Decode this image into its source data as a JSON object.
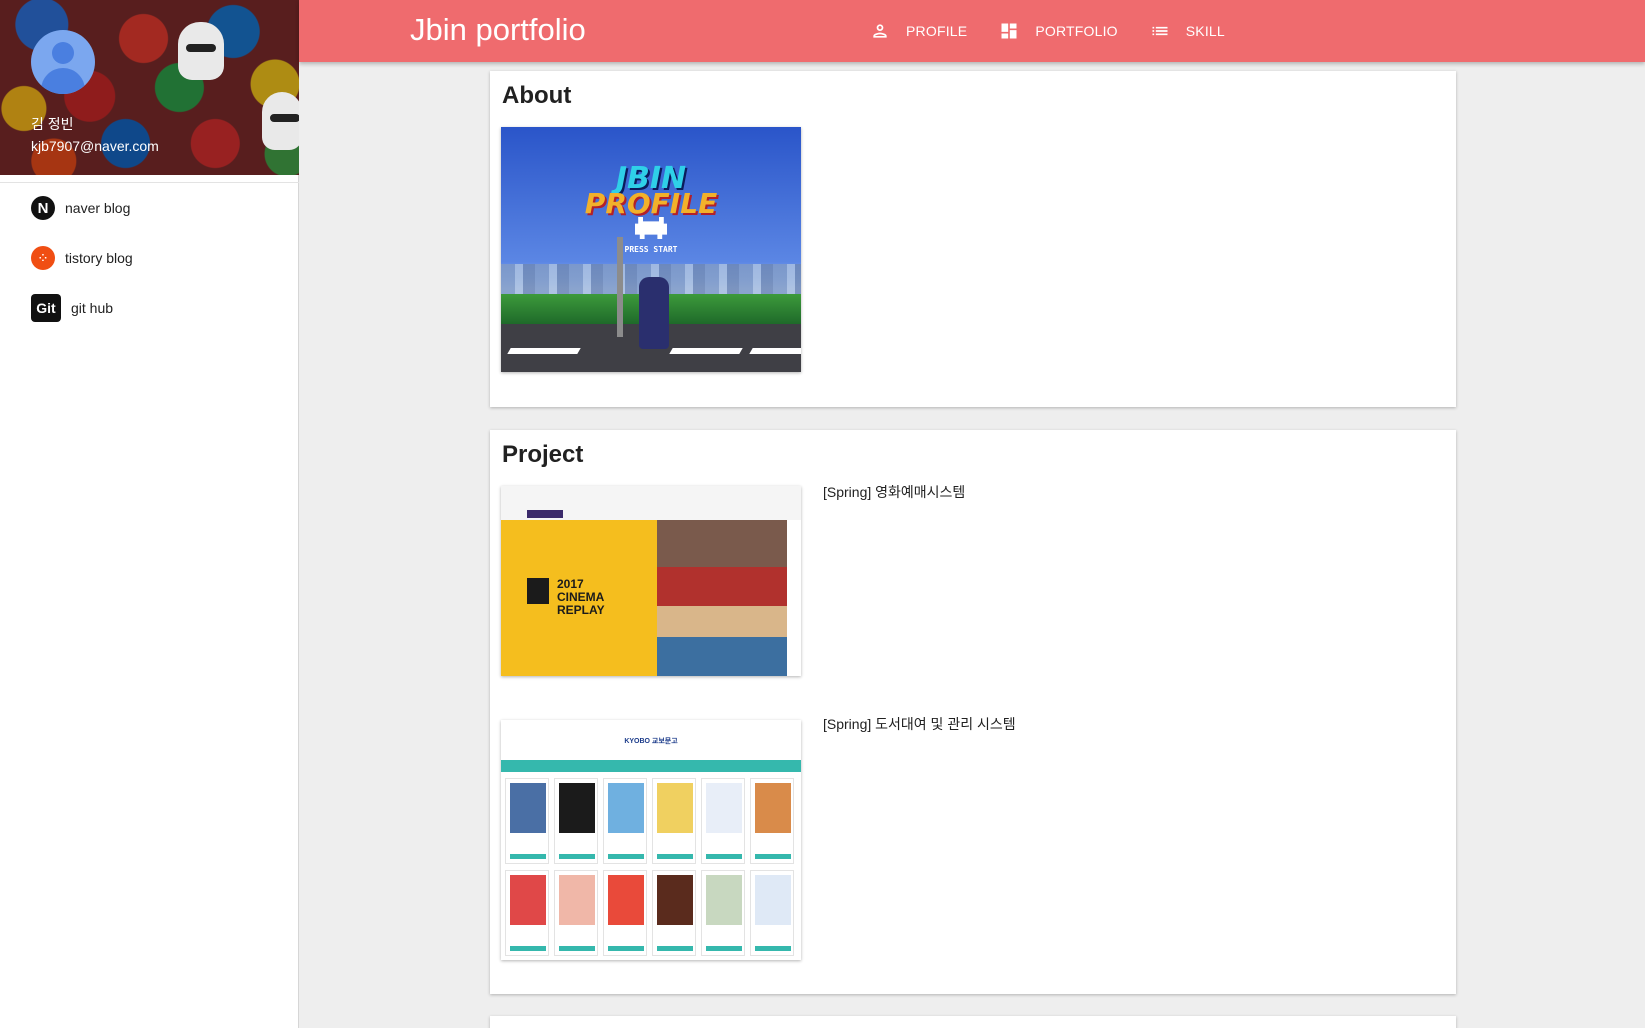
{
  "sidebar": {
    "user_name": "김 정빈",
    "user_email": "kjb7907@naver.com",
    "links": [
      {
        "label": "naver blog",
        "icon": "naver-icon"
      },
      {
        "label": "tistory blog",
        "icon": "tistory-icon"
      },
      {
        "label": "git hub",
        "icon": "github-icon"
      }
    ],
    "icon_glyphs": {
      "naver": "N",
      "tistory": "⁘",
      "git": "Git"
    }
  },
  "appbar": {
    "title": "Jbin portfolio",
    "nav": [
      {
        "label": "PROFILE",
        "icon": "person-icon"
      },
      {
        "label": "PORTFOLIO",
        "icon": "dashboard-icon"
      },
      {
        "label": "SKILL",
        "icon": "list-icon"
      }
    ],
    "color": "#ef6b6e"
  },
  "about": {
    "title": "About",
    "image": {
      "line1": "JBIN",
      "line2": "PROFILE",
      "caption": "PRESS START"
    }
  },
  "project": {
    "title": "Project",
    "items": [
      {
        "title": "[Spring] 영화예매시스템",
        "image_text": "2017\nCINEMA\nREPLAY"
      },
      {
        "title": "[Spring] 도서대여 및 관리 시스템",
        "image_text": "KYOBO 교보문고"
      }
    ]
  }
}
